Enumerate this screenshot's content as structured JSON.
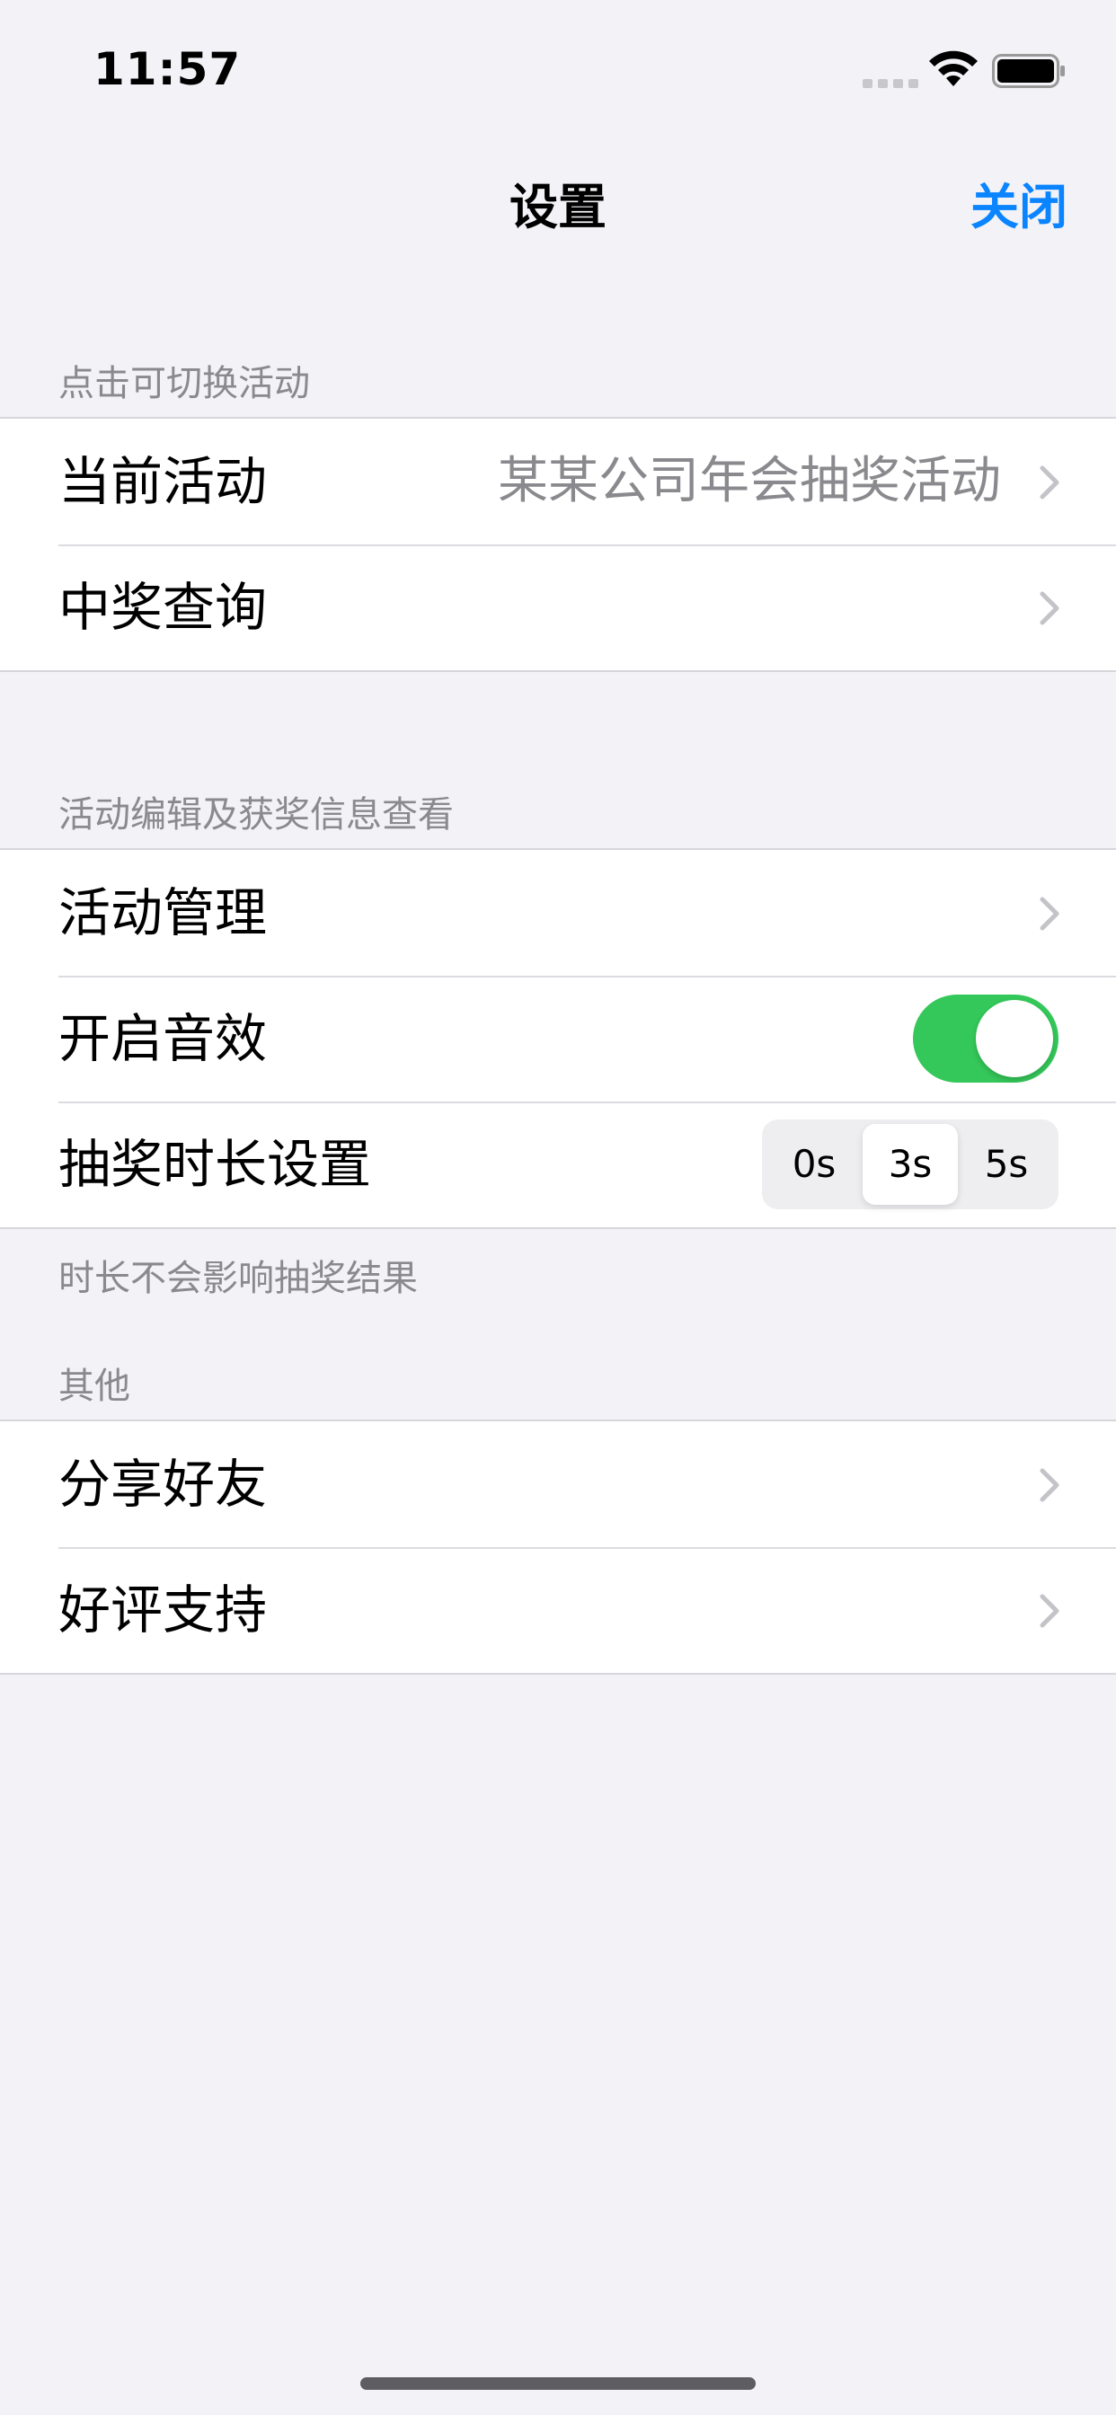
{
  "status_bar": {
    "time": "11:57"
  },
  "nav": {
    "title": "设置",
    "close_label": "关闭"
  },
  "sections": {
    "activity": {
      "header": "点击可切换活动",
      "current_activity": {
        "label": "当前活动",
        "value": "某某公司年会抽奖活动"
      },
      "winner_query": {
        "label": "中奖查询"
      }
    },
    "edit": {
      "header": "活动编辑及获奖信息查看",
      "activity_manage": {
        "label": "活动管理"
      },
      "sound": {
        "label": "开启音效",
        "on": true
      },
      "duration": {
        "label": "抽奖时长设置",
        "options": [
          "0s",
          "3s",
          "5s"
        ],
        "selected": "3s"
      },
      "footer": "时长不会影响抽奖结果"
    },
    "other": {
      "header": "其他",
      "share": {
        "label": "分享好友"
      },
      "review": {
        "label": "好评支持"
      }
    }
  },
  "colors": {
    "accent": "#0a84ff",
    "toggle_on": "#34c759",
    "background": "#f2f2f7"
  },
  "icons": [
    "wifi-icon",
    "battery-icon",
    "signal-icon",
    "chevron-right-icon"
  ]
}
